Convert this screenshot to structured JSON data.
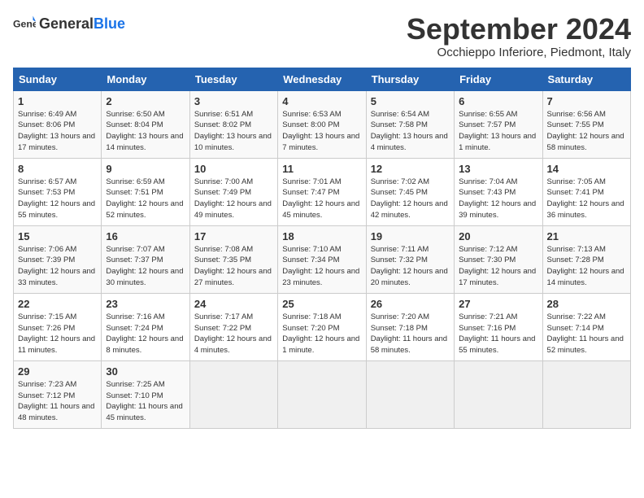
{
  "logo": {
    "general": "General",
    "blue": "Blue"
  },
  "title": "September 2024",
  "subtitle": "Occhieppo Inferiore, Piedmont, Italy",
  "headers": [
    "Sunday",
    "Monday",
    "Tuesday",
    "Wednesday",
    "Thursday",
    "Friday",
    "Saturday"
  ],
  "weeks": [
    [
      {
        "day": "1",
        "sunrise": "6:49 AM",
        "sunset": "8:06 PM",
        "daylight": "13 hours and 17 minutes."
      },
      {
        "day": "2",
        "sunrise": "6:50 AM",
        "sunset": "8:04 PM",
        "daylight": "13 hours and 14 minutes."
      },
      {
        "day": "3",
        "sunrise": "6:51 AM",
        "sunset": "8:02 PM",
        "daylight": "13 hours and 10 minutes."
      },
      {
        "day": "4",
        "sunrise": "6:53 AM",
        "sunset": "8:00 PM",
        "daylight": "13 hours and 7 minutes."
      },
      {
        "day": "5",
        "sunrise": "6:54 AM",
        "sunset": "7:58 PM",
        "daylight": "13 hours and 4 minutes."
      },
      {
        "day": "6",
        "sunrise": "6:55 AM",
        "sunset": "7:57 PM",
        "daylight": "13 hours and 1 minute."
      },
      {
        "day": "7",
        "sunrise": "6:56 AM",
        "sunset": "7:55 PM",
        "daylight": "12 hours and 58 minutes."
      }
    ],
    [
      {
        "day": "8",
        "sunrise": "6:57 AM",
        "sunset": "7:53 PM",
        "daylight": "12 hours and 55 minutes."
      },
      {
        "day": "9",
        "sunrise": "6:59 AM",
        "sunset": "7:51 PM",
        "daylight": "12 hours and 52 minutes."
      },
      {
        "day": "10",
        "sunrise": "7:00 AM",
        "sunset": "7:49 PM",
        "daylight": "12 hours and 49 minutes."
      },
      {
        "day": "11",
        "sunrise": "7:01 AM",
        "sunset": "7:47 PM",
        "daylight": "12 hours and 45 minutes."
      },
      {
        "day": "12",
        "sunrise": "7:02 AM",
        "sunset": "7:45 PM",
        "daylight": "12 hours and 42 minutes."
      },
      {
        "day": "13",
        "sunrise": "7:04 AM",
        "sunset": "7:43 PM",
        "daylight": "12 hours and 39 minutes."
      },
      {
        "day": "14",
        "sunrise": "7:05 AM",
        "sunset": "7:41 PM",
        "daylight": "12 hours and 36 minutes."
      }
    ],
    [
      {
        "day": "15",
        "sunrise": "7:06 AM",
        "sunset": "7:39 PM",
        "daylight": "12 hours and 33 minutes."
      },
      {
        "day": "16",
        "sunrise": "7:07 AM",
        "sunset": "7:37 PM",
        "daylight": "12 hours and 30 minutes."
      },
      {
        "day": "17",
        "sunrise": "7:08 AM",
        "sunset": "7:35 PM",
        "daylight": "12 hours and 27 minutes."
      },
      {
        "day": "18",
        "sunrise": "7:10 AM",
        "sunset": "7:34 PM",
        "daylight": "12 hours and 23 minutes."
      },
      {
        "day": "19",
        "sunrise": "7:11 AM",
        "sunset": "7:32 PM",
        "daylight": "12 hours and 20 minutes."
      },
      {
        "day": "20",
        "sunrise": "7:12 AM",
        "sunset": "7:30 PM",
        "daylight": "12 hours and 17 minutes."
      },
      {
        "day": "21",
        "sunrise": "7:13 AM",
        "sunset": "7:28 PM",
        "daylight": "12 hours and 14 minutes."
      }
    ],
    [
      {
        "day": "22",
        "sunrise": "7:15 AM",
        "sunset": "7:26 PM",
        "daylight": "12 hours and 11 minutes."
      },
      {
        "day": "23",
        "sunrise": "7:16 AM",
        "sunset": "7:24 PM",
        "daylight": "12 hours and 8 minutes."
      },
      {
        "day": "24",
        "sunrise": "7:17 AM",
        "sunset": "7:22 PM",
        "daylight": "12 hours and 4 minutes."
      },
      {
        "day": "25",
        "sunrise": "7:18 AM",
        "sunset": "7:20 PM",
        "daylight": "12 hours and 1 minute."
      },
      {
        "day": "26",
        "sunrise": "7:20 AM",
        "sunset": "7:18 PM",
        "daylight": "11 hours and 58 minutes."
      },
      {
        "day": "27",
        "sunrise": "7:21 AM",
        "sunset": "7:16 PM",
        "daylight": "11 hours and 55 minutes."
      },
      {
        "day": "28",
        "sunrise": "7:22 AM",
        "sunset": "7:14 PM",
        "daylight": "11 hours and 52 minutes."
      }
    ],
    [
      {
        "day": "29",
        "sunrise": "7:23 AM",
        "sunset": "7:12 PM",
        "daylight": "11 hours and 48 minutes."
      },
      {
        "day": "30",
        "sunrise": "7:25 AM",
        "sunset": "7:10 PM",
        "daylight": "11 hours and 45 minutes."
      },
      null,
      null,
      null,
      null,
      null
    ]
  ]
}
